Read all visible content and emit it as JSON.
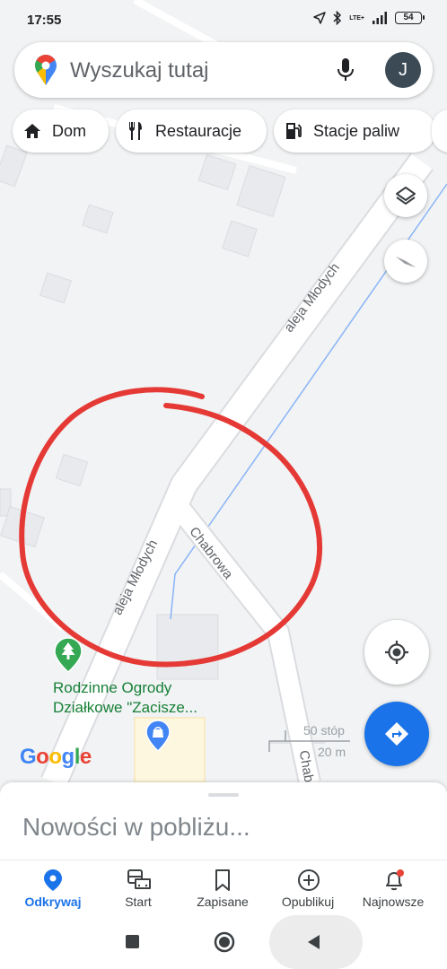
{
  "status_bar": {
    "time": "17:55",
    "battery": "54",
    "network": "LTE+"
  },
  "search": {
    "placeholder": "Wyszukaj tutaj",
    "avatar_letter": "J"
  },
  "chips": [
    {
      "label": "Dom",
      "icon": "home-icon"
    },
    {
      "label": "Restauracje",
      "icon": "restaurant-icon"
    },
    {
      "label": "Stacje paliw",
      "icon": "gas-station-icon"
    }
  ],
  "map": {
    "street_labels": [
      "aleja Młodych",
      "aleja Młodych",
      "Chabrowa",
      "Chabrowa"
    ],
    "poi": {
      "name_line1": "Rodzinne Ogrody",
      "name_line2": "Działkowe \"Zacisze...",
      "icon": "park-icon"
    },
    "scale": {
      "imperial": "50 stóp",
      "metric": "20 m"
    },
    "attribution": "Google",
    "colors": {
      "road": "#ffffff",
      "annotation": "#e53935",
      "waterway": "#8ab4f8",
      "poi": "#188038"
    }
  },
  "bottom_sheet": {
    "title": "Nowości w pobliżu..."
  },
  "bottom_nav": [
    {
      "label": "Odkrywaj",
      "icon": "explore-pin-icon",
      "active": true
    },
    {
      "label": "Start",
      "icon": "commute-icon",
      "active": false
    },
    {
      "label": "Zapisane",
      "icon": "bookmark-icon",
      "active": false
    },
    {
      "label": "Opublikuj",
      "icon": "add-circle-icon",
      "active": false
    },
    {
      "label": "Najnowsze",
      "icon": "bell-icon",
      "active": false
    }
  ]
}
